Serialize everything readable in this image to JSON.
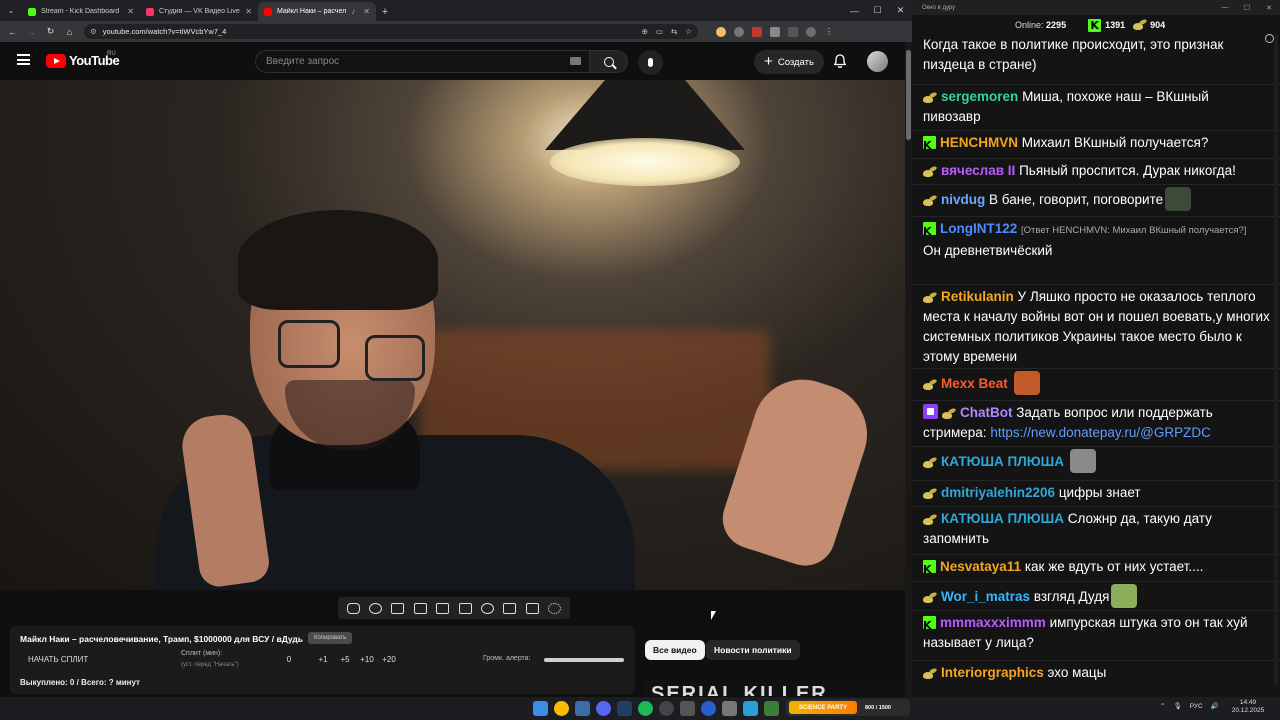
{
  "browser": {
    "tabs": [
      {
        "label": "Stream - Kick Dashboard",
        "color": "#53fc18",
        "active": false
      },
      {
        "label": "Студия — VK Видео Live",
        "color": "#ff3366",
        "active": false
      },
      {
        "label": "Майкл Наки – расчеловечі",
        "color": "#ff0000",
        "active": true
      }
    ],
    "url": "youtube.com/watch?v=tiWVcbYw7_4"
  },
  "youtube": {
    "logo_text": "YouTube",
    "country": "RU",
    "search_placeholder": "Введите запрос",
    "create_label": "Создать"
  },
  "panel": {
    "title": "Майкл Наки – расчеловечивание, Трамп, $1000000 для ВСУ / вДудь",
    "copy_label": "Копировать",
    "split_button": "НАЧАТЬ СПЛИТ",
    "split_minutes_label": "Сплит (мин):",
    "split_hint": "(уст. перед \"Начать\")",
    "split_values": [
      "0",
      "+1",
      "+5",
      "+10",
      "+20"
    ],
    "volume_label": "Громк. алерта:",
    "status": "Выкуплено: 0 / Всего: ? минут"
  },
  "categories": {
    "all": "Все видео",
    "politics": "Новости политики"
  },
  "thumbnail_text": "SERIAL KILLER",
  "chat": {
    "window_title": "Окно в дуру",
    "online_label": "Online:",
    "online_count": "2295",
    "kick_count": "1391",
    "other_count": "904",
    "messages": [
      {
        "badge": "",
        "user": "",
        "color": "#ffffff",
        "text": "Когда такое в политике происходит, это признак пиздеца в стране)"
      },
      {
        "badge": "g",
        "user": "sergemoren",
        "color": "#2fd3a3",
        "text": "Миша, похоже наш – ВКшный пивозавр"
      },
      {
        "badge": "k",
        "user": "HENCHMVN",
        "color": "#f2a51e",
        "text": "Михаил ВКшный получается?"
      },
      {
        "badge": "g",
        "user": "вячеслав II",
        "color": "#b95cff",
        "text": "Пьяный проспится. Дурак никогда!"
      },
      {
        "badge": "g",
        "user": "nivdug",
        "color": "#6aa9ff",
        "text": "В бане, говорит, поговорите"
      },
      {
        "badge": "k",
        "user": "LongINT122",
        "color": "#4d8bff",
        "reply": "[Ответ HENCHMVN: Михаил ВКшный получается?]",
        "text": "Он древнетвичёский"
      },
      {
        "badge": "g",
        "user": "Retikulanin",
        "color": "#f5a623",
        "text": "У Ляшко просто не оказалось теплого места к началу войны вот он и пошел воевать,у многих системных политиков  Украины такое место было к этому времени"
      },
      {
        "badge": "g",
        "user": "Mexx Beat",
        "color": "#ff5a2c",
        "text": ""
      },
      {
        "badge": "bot",
        "user": "ChatBot",
        "color": "#b388ff",
        "text": "Задать вопрос или поддержать стримера:",
        "link": "https://new.donatepay.ru/@GRPZDC"
      },
      {
        "badge": "g",
        "user": "КАТЮША ПЛЮША",
        "color": "#2fa8d8",
        "text": ""
      },
      {
        "badge": "g",
        "user": "dmitriyalehin2206",
        "color": "#2fa8d8",
        "text": "цифры знает"
      },
      {
        "badge": "g",
        "user": "КАТЮША ПЛЮША",
        "color": "#2fa8d8",
        "text": "Сложнр да, такую дату запомнить"
      },
      {
        "badge": "k",
        "user": "Nesvataya11",
        "color": "#f2a51e",
        "text": "как же вдуть от них устает...."
      },
      {
        "badge": "g",
        "user": "Wor_i_matras",
        "color": "#35b7ff",
        "text": "взгляд Дудя"
      },
      {
        "badge": "k",
        "user": "mmmaxxximmm",
        "color": "#b95cff",
        "text": "импурская штука это он так хуй называет у лица?"
      },
      {
        "badge": "g",
        "user": "Interiorgraphics",
        "color": "#f5a623",
        "text": "эхо мацы"
      }
    ]
  },
  "taskbar": {
    "promo_text": "SCIENCE PARTY",
    "promo_count": "800 / 1500",
    "lang": "РУС",
    "time": "14:49",
    "date": "20.12.2025"
  }
}
